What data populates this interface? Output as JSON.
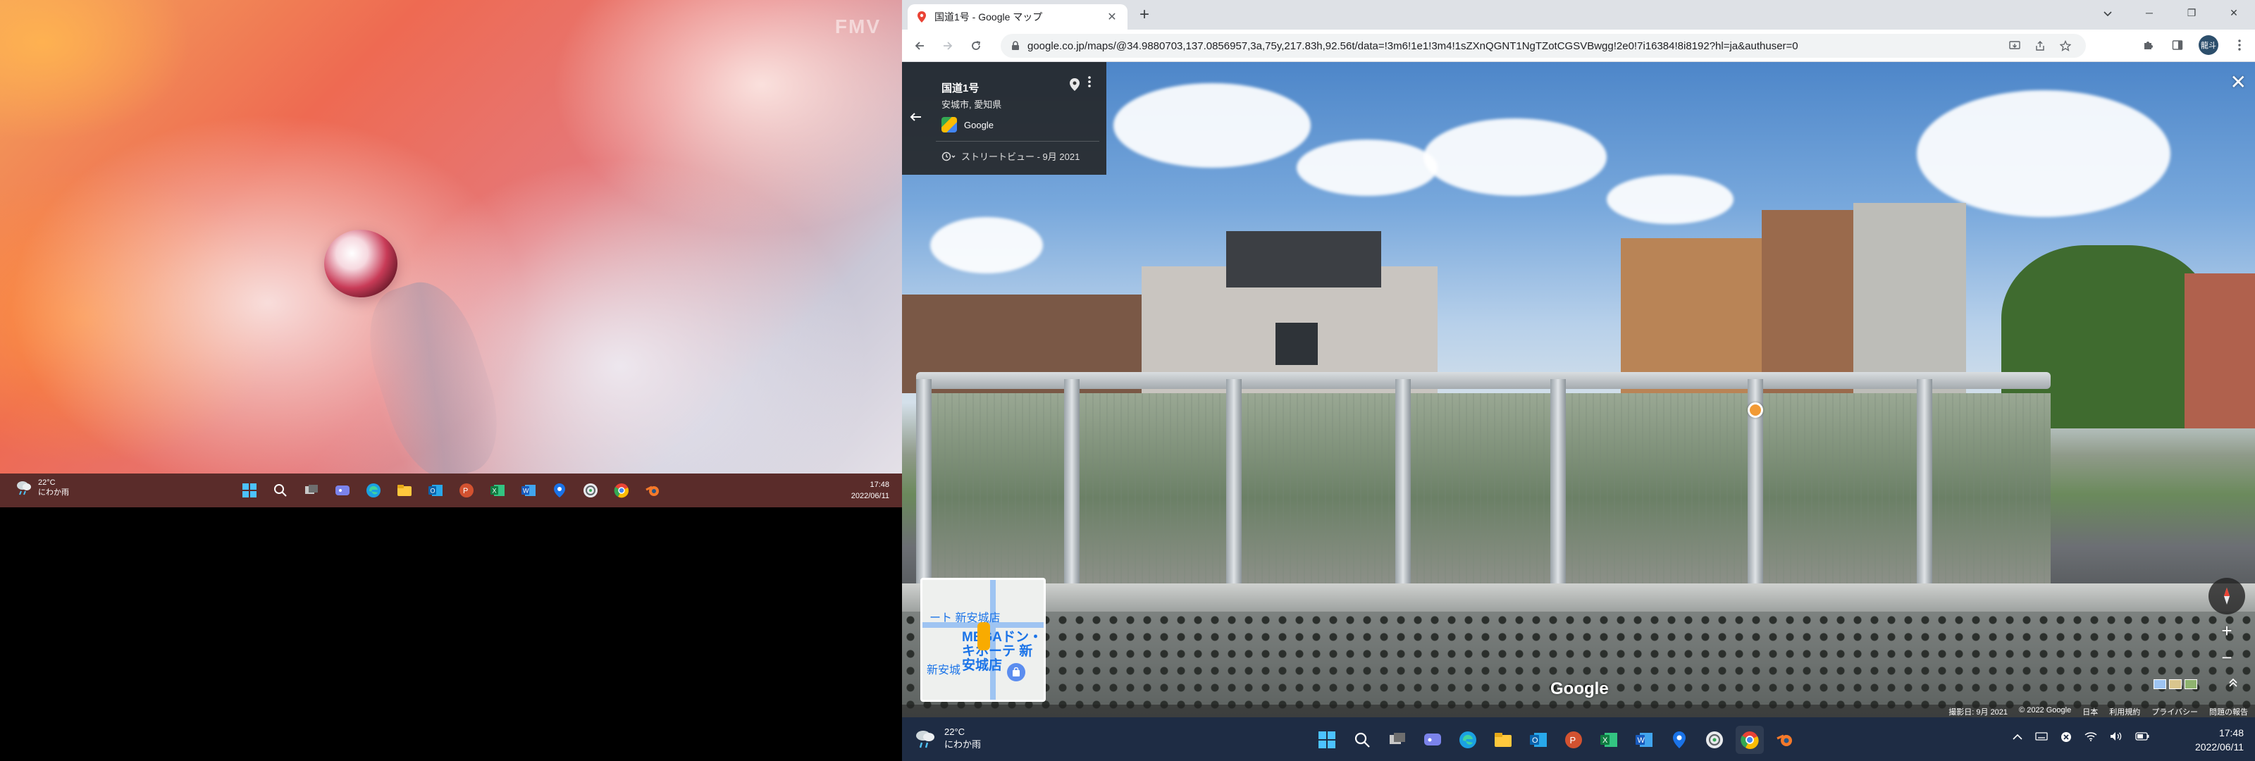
{
  "left_screen": {
    "wallpaper_brand": "FMV",
    "taskbar": {
      "weather_temp": "22°C",
      "weather_desc": "にわか雨",
      "time": "17:48",
      "date": "2022/06/11",
      "apps": [
        "windows-start",
        "search",
        "task-view",
        "teams-chat",
        "edge",
        "file-explorer",
        "outlook",
        "powerpoint",
        "excel",
        "word",
        "maps",
        "settings",
        "chrome",
        "blender"
      ]
    }
  },
  "browser": {
    "tab": {
      "title": "国道1号 - Google マップ",
      "close": "✕"
    },
    "new_tab": "+",
    "window_controls": {
      "minimize": "─",
      "restore": "❐",
      "close": "✕"
    },
    "url": "google.co.jp/maps/@34.9880703,137.0856957,3a,75y,217.83h,92.56t/data=!3m6!1e1!3m4!1sZXnQGNT1NgTZotCGSVBwgg!2e0!7i16384!8i8192?hl=ja&authuser=0",
    "profile_initials": "龍斗"
  },
  "streetview": {
    "place_name": "国道1号",
    "place_sub": "安城市, 愛知県",
    "provider": "Google",
    "capture_date": "ストリートビュー - 9月 2021",
    "close": "✕",
    "minimap": {
      "label_top": "ート 新安城店",
      "label_main": "MEGAドン・キホーテ 新安城店",
      "label_bottom": "新安城"
    },
    "zoom_in": "+",
    "zoom_out": "−",
    "watermark": "Google",
    "footer": {
      "capture": "撮影日: 9月 2021",
      "copyright": "© 2022 Google",
      "region": "日本",
      "terms": "利用規約",
      "privacy": "プライバシー",
      "report": "問題の報告"
    }
  },
  "right_taskbar": {
    "weather_temp": "22°C",
    "weather_desc": "にわか雨",
    "time": "17:48",
    "date": "2022/06/11",
    "apps": [
      "windows-start",
      "search",
      "task-view",
      "teams-chat",
      "edge",
      "file-explorer",
      "outlook",
      "powerpoint",
      "excel",
      "word",
      "maps",
      "settings",
      "chrome",
      "blender"
    ]
  },
  "colors": {
    "left_taskbar": "#5a2c2a",
    "right_taskbar": "#1e2c44",
    "chrome_frame": "#dee1e6",
    "info_card": "#222222"
  }
}
